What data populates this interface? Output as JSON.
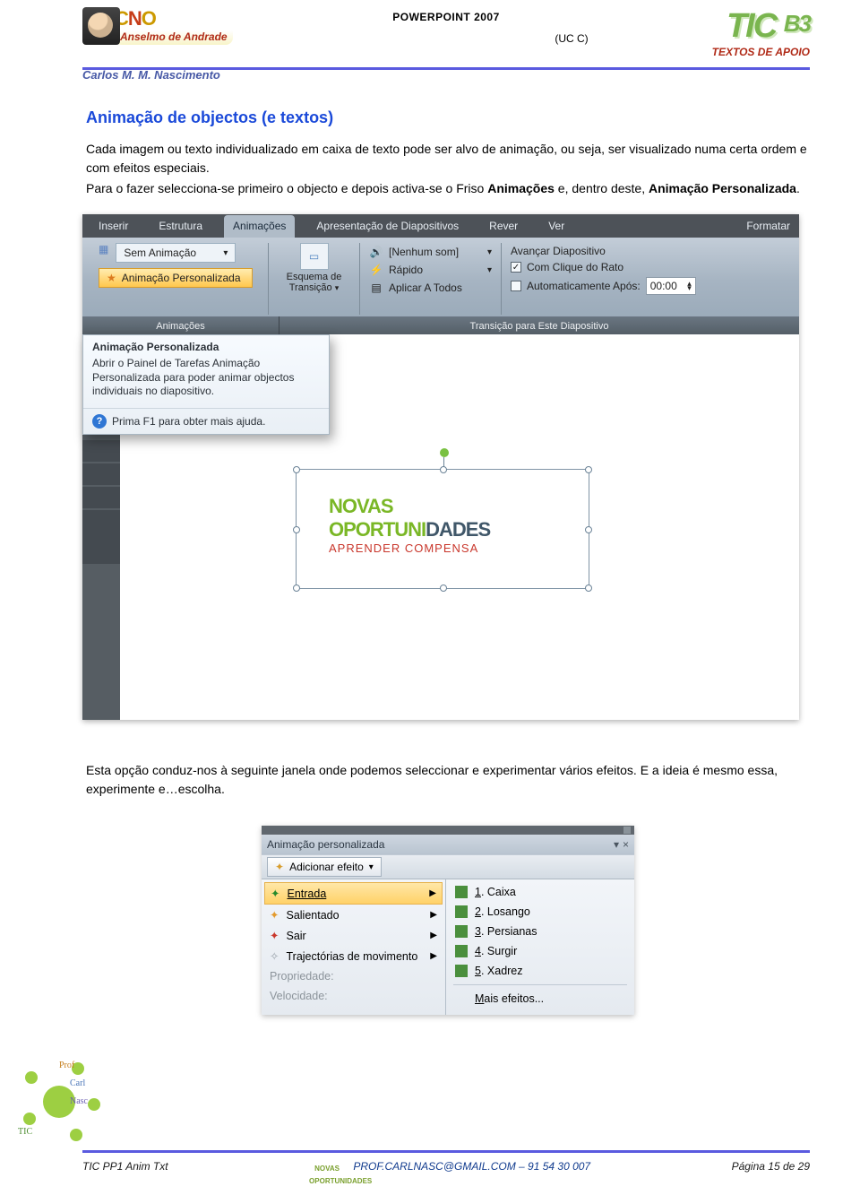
{
  "header": {
    "doc_title": "POWERPOINT 2007",
    "doc_sub": "(UC C)",
    "tic": "TIC",
    "tic_b3": "B3",
    "apoio": "TEXTOS DE APOIO",
    "author": "Carlos M. M. Nascimento",
    "cno_left": "C",
    "cno_mid": "N",
    "cno_right": "O",
    "anselmo": "Anselmo de Andrade"
  },
  "h2": "Animação de objectos (e textos)",
  "p1": "Cada imagem ou texto individualizado em caixa de texto pode ser alvo de animação, ou seja, ser visualizado numa certa ordem e com efeitos especiais.",
  "p2a": "Para o fazer selecciona-se primeiro o objecto e depois activa-se o Friso ",
  "p2b": "Animações",
  "p2c": " e, dentro deste, ",
  "p2d": "Animação Personalizada",
  "p2e": ".",
  "ribbon": {
    "tabs": [
      "Inserir",
      "Estrutura",
      "Animações",
      "Apresentação de Diapositivos",
      "Rever",
      "Ver",
      "Formatar"
    ],
    "active_tab_index": 2,
    "sem_anim": "Sem Animação",
    "pers": "Animação Personalizada",
    "esq_l1": "Esquema de",
    "esq_l2": "Transição",
    "r3_a": "[Nenhum som]",
    "r3_b": "Rápido",
    "r3_c": "Aplicar A Todos",
    "r4_a": "Avançar Diapositivo",
    "r4_b": "Com Clique do Rato",
    "r4_c": "Automaticamente Após:",
    "r4_c_val": "00:00",
    "grp_titles": [
      "Animações",
      "Transição para Este Diapositivo"
    ],
    "tooltip_title": "Animação Personalizada",
    "tooltip_body": "Abrir o Painel de Tarefas Animação Personalizada para poder animar objectos individuais no diapositivo.",
    "tooltip_foot": "Prima F1 para obter mais ajuda."
  },
  "logo": {
    "line1a": "NOVAS",
    "line1b": "OPORTUNIDADES",
    "line2": "APRENDER COMPENSA"
  },
  "p3": "Esta opção conduz-nos à seguinte janela onde podemos seleccionar e experimentar vários efeitos. E a ideia é mesmo essa, experimente e…escolha.",
  "animpane": {
    "title": "Animação personalizada",
    "add_btn": "Adicionar efeito",
    "left": [
      {
        "label": "Entrada",
        "star": "green",
        "active": true
      },
      {
        "label": "Salientado",
        "star": "orange"
      },
      {
        "label": "Sair",
        "star": "red"
      },
      {
        "label": "Trajectórias de movimento",
        "star": "grey"
      }
    ],
    "left_disabled": [
      "Propriedade:",
      "Velocidade:"
    ],
    "right": [
      {
        "n": "1",
        "label": "Caixa"
      },
      {
        "n": "2",
        "label": "Losango"
      },
      {
        "n": "3",
        "label": "Persianas"
      },
      {
        "n": "4",
        "label": "Surgir"
      },
      {
        "n": "5",
        "label": "Xadrez"
      }
    ],
    "right_more": "Mais efeitos..."
  },
  "footer": {
    "left": "TIC PP1 Anim Txt",
    "center": "PROF.CARLNASC@GMAIL.COM – 91 54 30 007",
    "right": "Página 15 de 29"
  },
  "blob": {
    "prof": "Prof",
    "carl": "Carl",
    "nasc": "Nasc",
    "tic": "TIC"
  }
}
